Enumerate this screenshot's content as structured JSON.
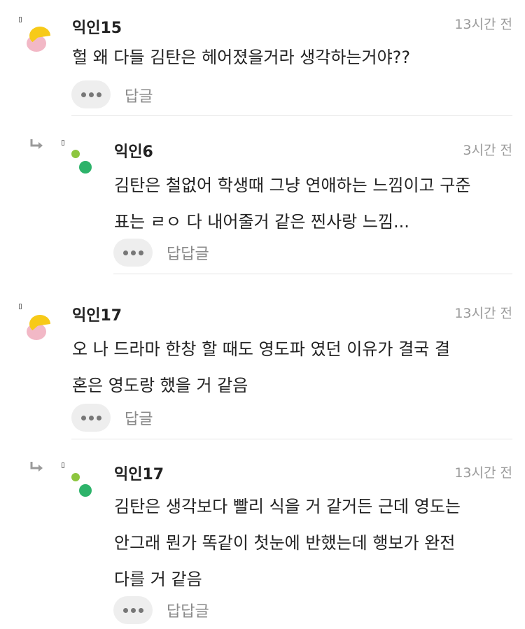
{
  "comments": [
    {
      "name": "익인15",
      "time": "13시간 전",
      "text": "헐 왜 다들 김탄은 헤어졌을거라 생각하는거야??",
      "action": "답글"
    },
    {
      "name": "익인6",
      "time": "3시간 전",
      "text": "김탄은 철없어 학생때 그냥 연애하는 느낌이고 구준\n표는 ㄹㅇ 다 내어줄거 같은 찐사랑 느낌...",
      "action": "답답글"
    },
    {
      "name": "익인17",
      "time": "13시간 전",
      "text": "오 나 드라마 한창 할 때도 영도파 였던 이유가 결국 결\n혼은 영도랑 했을 거 같음",
      "action": "답글"
    },
    {
      "name": "익인17",
      "time": "13시간 전",
      "text": "김탄은 생각보다 빨리 식을 거 같거든 근데 영도는\n안그래 뭔가 똑같이 첫눈에 반했는데 행보가 완전\n다를 거 같음",
      "action": "답답글"
    }
  ],
  "icons": {
    "more": "more-dots-icon",
    "reply_indicator": "reply-arrow-icon",
    "avatar_top_level": "yellow-pink-avatar",
    "avatar_reply": "green-dots-avatar"
  },
  "colors": {
    "avatar_yellow": "#f7ca18",
    "avatar_pink": "#f2b8c6",
    "avatar_green_light": "#8dc63f",
    "avatar_green_dark": "#2db36a",
    "timestamp": "#9a9a9a",
    "button_bg": "#eeeeee"
  }
}
